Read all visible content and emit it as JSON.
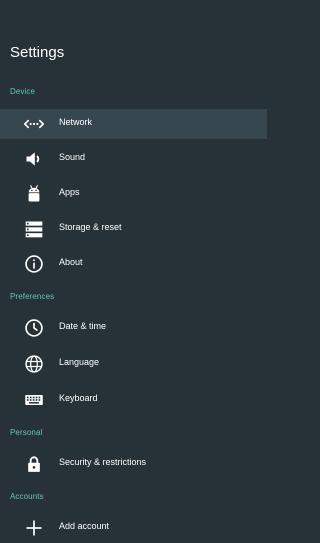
{
  "header": {
    "title": "Settings"
  },
  "sections": {
    "device": "Device",
    "preferences": "Preferences",
    "personal": "Personal",
    "accounts": "Accounts"
  },
  "items": {
    "network": {
      "label": "Network",
      "icon": "network-arrows-icon"
    },
    "sound": {
      "label": "Sound",
      "icon": "volume-icon"
    },
    "apps": {
      "label": "Apps",
      "icon": "android-icon"
    },
    "storage": {
      "label": "Storage & reset",
      "icon": "storage-icon"
    },
    "about": {
      "label": "About",
      "icon": "info-icon"
    },
    "date_time": {
      "label": "Date & time",
      "icon": "clock-icon"
    },
    "language": {
      "label": "Language",
      "icon": "globe-icon"
    },
    "keyboard": {
      "label": "Keyboard",
      "icon": "keyboard-icon"
    },
    "security": {
      "label": "Security & restrictions",
      "icon": "lock-icon"
    },
    "add_account": {
      "label": "Add account",
      "icon": "plus-icon"
    }
  },
  "colors": {
    "background": "#263238",
    "selected": "#37474f",
    "section_header": "#62c3b7",
    "text": "#ffffff"
  }
}
